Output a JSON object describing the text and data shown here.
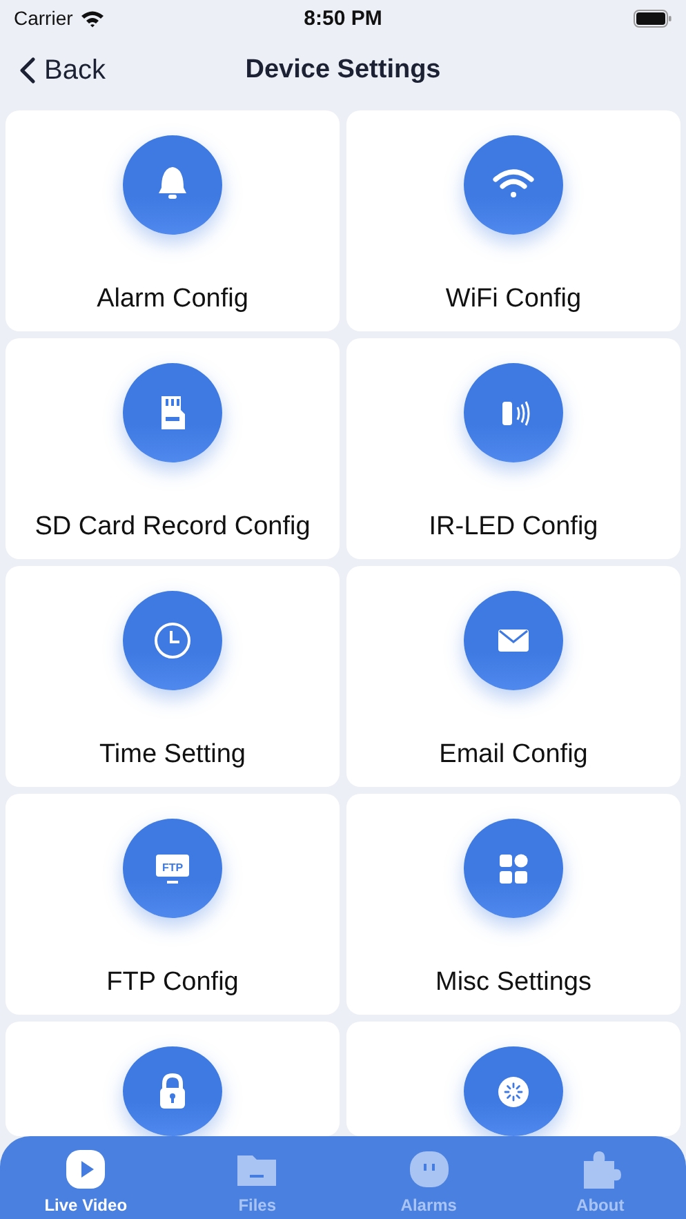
{
  "status_bar": {
    "carrier": "Carrier",
    "time": "8:50 PM"
  },
  "nav": {
    "back": "Back",
    "title": "Device Settings"
  },
  "items": [
    {
      "label": "Alarm Config",
      "kind": "bell"
    },
    {
      "label": "WiFi Config",
      "kind": "wifi"
    },
    {
      "label": "SD Card Record Config",
      "kind": "sdcard"
    },
    {
      "label": "IR-LED Config",
      "kind": "irled"
    },
    {
      "label": "Time Setting",
      "kind": "clock"
    },
    {
      "label": "Email Config",
      "kind": "mail"
    },
    {
      "label": "FTP Config",
      "kind": "ftp",
      "icon_text": "FTP"
    },
    {
      "label": "Misc Settings",
      "kind": "grid"
    },
    {
      "kind": "lock"
    },
    {
      "kind": "reboot"
    }
  ],
  "tabs": [
    {
      "label": "Live Video",
      "kind": "play",
      "selected": true
    },
    {
      "label": "Files",
      "kind": "folder",
      "selected": false
    },
    {
      "label": "Alarms",
      "kind": "chat",
      "selected": false
    },
    {
      "label": "About",
      "kind": "puzzle",
      "selected": false
    }
  ]
}
